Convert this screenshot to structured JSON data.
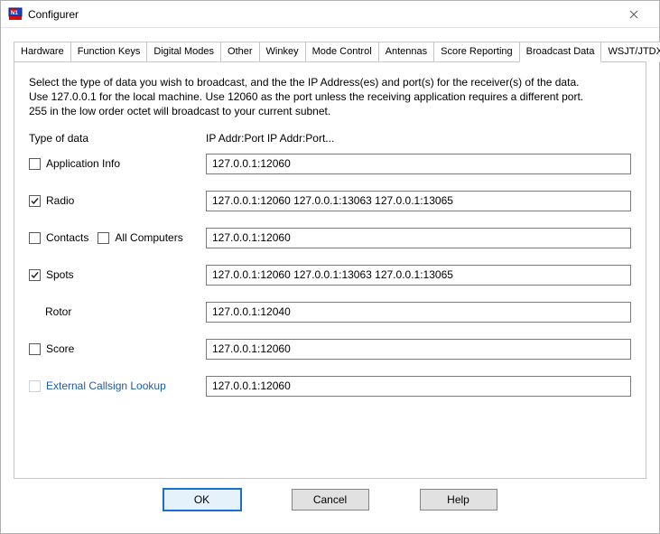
{
  "window": {
    "title": "Configurer"
  },
  "tabs": {
    "items": [
      {
        "label": "Hardware"
      },
      {
        "label": "Function Keys"
      },
      {
        "label": "Digital Modes"
      },
      {
        "label": "Other"
      },
      {
        "label": "Winkey"
      },
      {
        "label": "Mode Control"
      },
      {
        "label": "Antennas"
      },
      {
        "label": "Score Reporting"
      },
      {
        "label": "Broadcast Data"
      },
      {
        "label": "WSJT/JTDX Setup"
      }
    ],
    "active_index": 8
  },
  "intro": {
    "line1": "Select the type of data you wish to broadcast, and the the IP Address(es) and port(s) for the receiver(s) of the data.",
    "line2": "Use 127.0.0.1 for the local machine.  Use 12060 as the port unless the receiving application requires a different port.",
    "line3": "255 in the low order octet will broadcast to your current subnet."
  },
  "columns": {
    "type": "Type of data",
    "addr": "IP Addr:Port IP Addr:Port..."
  },
  "rows": {
    "app_info": {
      "checked": false,
      "label": "Application Info",
      "value": "127.0.0.1:12060"
    },
    "radio": {
      "checked": true,
      "label": "Radio",
      "value": "127.0.0.1:12060 127.0.0.1:13063 127.0.0.1:13065"
    },
    "contacts": {
      "checked": false,
      "label": "Contacts",
      "all_checked": false,
      "all_label": "All Computers",
      "value": "127.0.0.1:12060"
    },
    "spots": {
      "checked": true,
      "label": "Spots",
      "value": "127.0.0.1:12060 127.0.0.1:13063 127.0.0.1:13065"
    },
    "rotor": {
      "label": "Rotor",
      "value": "127.0.0.1:12040"
    },
    "score": {
      "checked": false,
      "label": "Score",
      "value": "127.0.0.1:12060"
    },
    "external_callsign": {
      "checked": false,
      "label": "External Callsign Lookup",
      "value": "127.0.0.1:12060"
    }
  },
  "buttons": {
    "ok": "OK",
    "cancel": "Cancel",
    "help": "Help"
  }
}
